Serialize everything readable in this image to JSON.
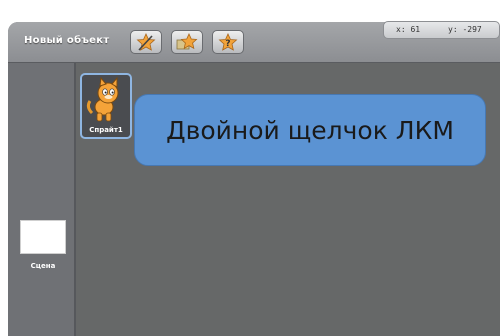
{
  "toolbar": {
    "title": "Новый объект",
    "buttons": [
      {
        "icon": "paint-new-sprite-icon"
      },
      {
        "icon": "choose-sprite-from-file-icon"
      },
      {
        "icon": "random-sprite-icon"
      }
    ],
    "coords": {
      "x": "x: 61",
      "y": "y: -297"
    }
  },
  "stage": {
    "label": "Сцена"
  },
  "sprites": [
    {
      "label": "Спрайт1",
      "selected": true
    }
  ],
  "callout": {
    "text": "Двойной щелчок ЛКМ"
  },
  "colors": {
    "panel": "#6f7175",
    "sprite_area": "#666868",
    "toolbar": "#9a9c9f",
    "callout": "#5b93d3",
    "selection": "#8fb6e2"
  }
}
